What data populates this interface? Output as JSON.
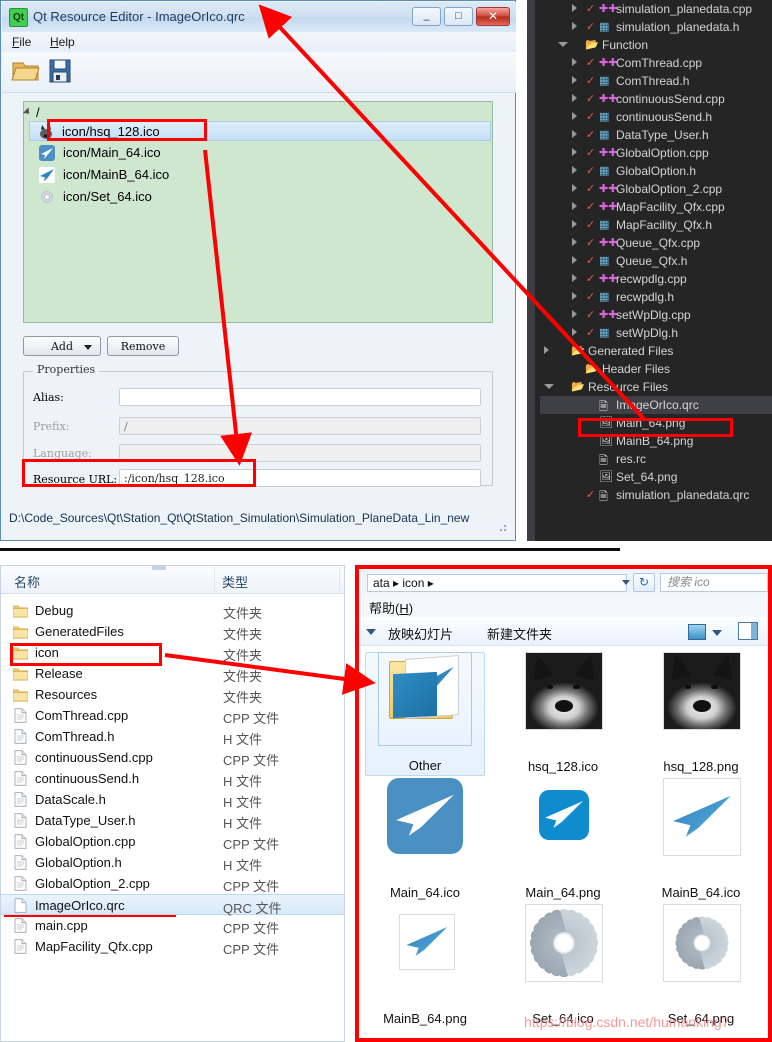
{
  "qt_window": {
    "title": "Qt Resource Editor - ImageOrIco.qrc",
    "logo_text": "Qt",
    "window_buttons": {
      "minimize": "–",
      "maximize": "□",
      "close": "✕"
    },
    "menus": [
      {
        "label": "File",
        "mnemonic": "F"
      },
      {
        "label": "Help",
        "mnemonic": "H"
      }
    ],
    "toolbar": [
      {
        "name": "open-folder-icon",
        "label": "Open"
      },
      {
        "name": "save-icon",
        "label": "Save"
      }
    ],
    "tree": {
      "root": "/",
      "items": [
        {
          "label": "icon/hsq_128.ico",
          "icon": "husky-icon",
          "selected": true
        },
        {
          "label": "icon/Main_64.ico",
          "icon": "paper-plane-icon",
          "selected": false
        },
        {
          "label": "icon/MainB_64.ico",
          "icon": "paper-plane-outline-icon",
          "selected": false
        },
        {
          "label": "icon/Set_64.ico",
          "icon": "gear-icon",
          "selected": false
        }
      ]
    },
    "buttons": {
      "add": "Add",
      "remove": "Remove"
    },
    "properties": {
      "group_title": "Properties",
      "fields": [
        {
          "label": "Alias:",
          "value": "",
          "enabled": true
        },
        {
          "label": "Prefix:",
          "value": "/",
          "enabled": false
        },
        {
          "label": "Language:",
          "value": "",
          "enabled": false
        },
        {
          "label": "Resource URL:",
          "value": ":/icon/hsq_128.ico",
          "enabled": true
        }
      ]
    },
    "status_path": "D:\\Code_Sources\\Qt\\Station_Qt\\QtStation_Simulation\\Simulation_PlaneData_Lin_new"
  },
  "solution_explorer": {
    "rows": [
      {
        "label": "simulation_planedata.cpp",
        "indent": 3,
        "expander": "collapsed",
        "check": true,
        "icon": "cpp-file-icon",
        "selected": false
      },
      {
        "label": "simulation_planedata.h",
        "indent": 3,
        "expander": "collapsed",
        "check": true,
        "icon": "h-file-icon",
        "selected": false
      },
      {
        "label": "Function",
        "indent": 2,
        "expander": "expanded",
        "check": false,
        "icon": "filter-folder-icon",
        "selected": false
      },
      {
        "label": "ComThread.cpp",
        "indent": 3,
        "expander": "collapsed",
        "check": true,
        "icon": "cpp-file-icon",
        "selected": false
      },
      {
        "label": "ComThread.h",
        "indent": 3,
        "expander": "collapsed",
        "check": true,
        "icon": "h-file-icon",
        "selected": false
      },
      {
        "label": "continuousSend.cpp",
        "indent": 3,
        "expander": "collapsed",
        "check": true,
        "icon": "cpp-file-icon",
        "selected": false
      },
      {
        "label": "continuousSend.h",
        "indent": 3,
        "expander": "collapsed",
        "check": true,
        "icon": "h-file-icon",
        "selected": false
      },
      {
        "label": "DataType_User.h",
        "indent": 3,
        "expander": "collapsed",
        "check": true,
        "icon": "h-file-icon",
        "selected": false
      },
      {
        "label": "GlobalOption.cpp",
        "indent": 3,
        "expander": "collapsed",
        "check": true,
        "icon": "cpp-file-icon",
        "selected": false
      },
      {
        "label": "GlobalOption.h",
        "indent": 3,
        "expander": "collapsed",
        "check": true,
        "icon": "h-file-icon",
        "selected": false
      },
      {
        "label": "GlobalOption_2.cpp",
        "indent": 3,
        "expander": "collapsed",
        "check": true,
        "icon": "cpp-file-icon",
        "selected": false
      },
      {
        "label": "MapFacility_Qfx.cpp",
        "indent": 3,
        "expander": "collapsed",
        "check": true,
        "icon": "cpp-file-icon",
        "selected": false
      },
      {
        "label": "MapFacility_Qfx.h",
        "indent": 3,
        "expander": "collapsed",
        "check": true,
        "icon": "h-file-icon",
        "selected": false
      },
      {
        "label": "Queue_Qfx.cpp",
        "indent": 3,
        "expander": "collapsed",
        "check": true,
        "icon": "cpp-file-icon",
        "selected": false
      },
      {
        "label": "Queue_Qfx.h",
        "indent": 3,
        "expander": "collapsed",
        "check": true,
        "icon": "h-file-icon",
        "selected": false
      },
      {
        "label": "recwpdlg.cpp",
        "indent": 3,
        "expander": "collapsed",
        "check": true,
        "icon": "cpp-file-icon",
        "selected": false
      },
      {
        "label": "recwpdlg.h",
        "indent": 3,
        "expander": "collapsed",
        "check": true,
        "icon": "h-file-icon",
        "selected": false
      },
      {
        "label": "setWpDlg.cpp",
        "indent": 3,
        "expander": "collapsed",
        "check": true,
        "icon": "cpp-file-icon",
        "selected": false
      },
      {
        "label": "setWpDlg.h",
        "indent": 3,
        "expander": "collapsed",
        "check": true,
        "icon": "h-file-icon",
        "selected": false
      },
      {
        "label": "Generated Files",
        "indent": 1,
        "expander": "collapsed",
        "check": false,
        "icon": "filter-folder-icon",
        "selected": false
      },
      {
        "label": "Header Files",
        "indent": 2,
        "expander": "none",
        "check": false,
        "icon": "filter-folder-icon",
        "selected": false
      },
      {
        "label": "Resource Files",
        "indent": 1,
        "expander": "expanded",
        "check": false,
        "icon": "filter-folder-icon",
        "selected": false
      },
      {
        "label": "ImageOrIco.qrc",
        "indent": 3,
        "expander": "none",
        "check": false,
        "icon": "lock-doc-icon",
        "selected": true
      },
      {
        "label": "Main_64.png",
        "indent": 3,
        "expander": "none",
        "check": false,
        "icon": "image-excluded-icon",
        "selected": false
      },
      {
        "label": "MainB_64.png",
        "indent": 3,
        "expander": "none",
        "check": false,
        "icon": "image-excluded-icon",
        "selected": false
      },
      {
        "label": "res.rc",
        "indent": 3,
        "expander": "none",
        "check": false,
        "icon": "lock-doc-icon",
        "selected": false
      },
      {
        "label": "Set_64.png",
        "indent": 3,
        "expander": "none",
        "check": false,
        "icon": "image-excluded-icon",
        "selected": false
      },
      {
        "label": "simulation_planedata.qrc",
        "indent": 3,
        "expander": "none",
        "check": true,
        "icon": "doc-icon",
        "selected": false
      }
    ]
  },
  "file_explorer_details": {
    "columns": {
      "name": "名称",
      "type": "类型"
    },
    "rows": [
      {
        "name": "Debug",
        "type": "文件夹",
        "icon": "folder-icon",
        "selected": false
      },
      {
        "name": "GeneratedFiles",
        "type": "文件夹",
        "icon": "folder-icon",
        "selected": false
      },
      {
        "name": "icon",
        "type": "文件夹",
        "icon": "folder-icon",
        "selected": false
      },
      {
        "name": "Release",
        "type": "文件夹",
        "icon": "folder-icon",
        "selected": false
      },
      {
        "name": "Resources",
        "type": "文件夹",
        "icon": "folder-icon",
        "selected": false
      },
      {
        "name": "ComThread.cpp",
        "type": "CPP 文件",
        "icon": "file-icon",
        "selected": false
      },
      {
        "name": "ComThread.h",
        "type": "H 文件",
        "icon": "file-icon",
        "selected": false
      },
      {
        "name": "continuousSend.cpp",
        "type": "CPP 文件",
        "icon": "file-icon",
        "selected": false
      },
      {
        "name": "continuousSend.h",
        "type": "H 文件",
        "icon": "file-icon",
        "selected": false
      },
      {
        "name": "DataScale.h",
        "type": "H 文件",
        "icon": "file-icon",
        "selected": false
      },
      {
        "name": "DataType_User.h",
        "type": "H 文件",
        "icon": "file-icon",
        "selected": false
      },
      {
        "name": "GlobalOption.cpp",
        "type": "CPP 文件",
        "icon": "file-icon",
        "selected": false
      },
      {
        "name": "GlobalOption.h",
        "type": "H 文件",
        "icon": "file-icon",
        "selected": false
      },
      {
        "name": "GlobalOption_2.cpp",
        "type": "CPP 文件",
        "icon": "file-icon",
        "selected": false
      },
      {
        "name": "ImageOrIco.qrc",
        "type": "QRC 文件",
        "icon": "qrc-file-icon",
        "selected": true
      },
      {
        "name": "main.cpp",
        "type": "CPP 文件",
        "icon": "file-icon",
        "selected": false
      },
      {
        "name": "MapFacility_Qfx.cpp",
        "type": "CPP 文件",
        "icon": "file-icon",
        "selected": false
      }
    ]
  },
  "icon_explorer": {
    "breadcrumb": "ata  ▸  icon  ▸",
    "refresh_glyph": "↻",
    "search_placeholder": "搜索 ico",
    "menu": {
      "help": "帮助",
      "help_mnemonic": "H"
    },
    "toolbar": {
      "slideshow": "放映幻灯片",
      "new_folder": "新建文件夹"
    },
    "items": [
      {
        "name": "Other",
        "kind": "folder",
        "selected": true
      },
      {
        "name": "hsq_128.ico",
        "kind": "husky",
        "selected": false
      },
      {
        "name": "hsq_128.png",
        "kind": "husky",
        "selected": false
      },
      {
        "name": "Main_64.ico",
        "kind": "plane-solid",
        "selected": false
      },
      {
        "name": "Main_64.png",
        "kind": "plane-small",
        "selected": false
      },
      {
        "name": "MainB_64.ico",
        "kind": "plane-white",
        "selected": false
      },
      {
        "name": "MainB_64.png",
        "kind": "plane-white-small",
        "selected": false
      },
      {
        "name": "Set_64.ico",
        "kind": "gear",
        "selected": false
      },
      {
        "name": "Set_64.png",
        "kind": "gear-small",
        "selected": false
      }
    ]
  },
  "watermark": "https://blog.csdn.net/humanking7",
  "colors": {
    "annotation": "#ff0000",
    "qt_tree_bg": "#cfe6cf",
    "vs_bg": "#252526",
    "accent": "#41cd52"
  }
}
